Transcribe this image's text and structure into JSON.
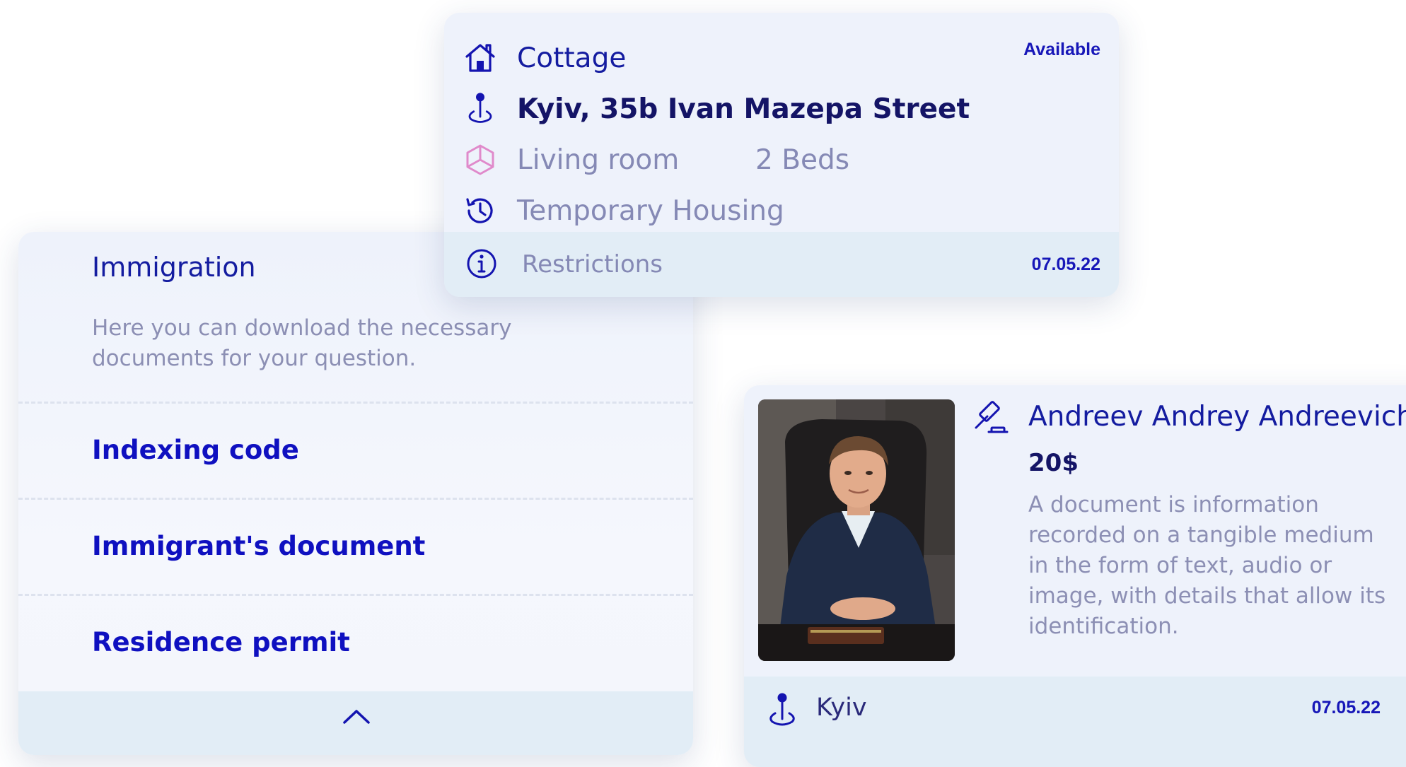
{
  "housing": {
    "type_label": "Cottage",
    "status": "Available",
    "address": "Kyiv, 35b Ivan Mazepa Street",
    "room": "Living room",
    "beds": "2 Beds",
    "category": "Temporary Housing",
    "restrictions_label": "Restrictions",
    "date": "07.05.22",
    "icons": [
      "home-icon",
      "map-pin-icon",
      "cube-icon",
      "history-icon",
      "info-icon"
    ]
  },
  "immigration": {
    "title": "Immigration",
    "description": "Here you can download the necessary documents for your question.",
    "documents": [
      {
        "label": "Indexing code"
      },
      {
        "label": "Immigrant's document"
      },
      {
        "label": "Residence permit"
      }
    ],
    "collapse_icon": "chevron-up-icon"
  },
  "lawyer": {
    "name": "Andreev Andrey Andreevich",
    "price": "20$",
    "description": "A document is information recorded on a tangible medium in the form of text, audio or image, with details that allow its identification.",
    "city": "Kyiv",
    "date": "07.05.22",
    "icons": [
      "gavel-icon",
      "map-pin-icon"
    ]
  },
  "colors": {
    "accent": "#0f10c0",
    "heading": "#141ca0",
    "muted": "#8c8fb4",
    "card_bg": "#eef2fb",
    "footer_bg": "#e2edf6",
    "cube_pink": "#e08acb"
  }
}
